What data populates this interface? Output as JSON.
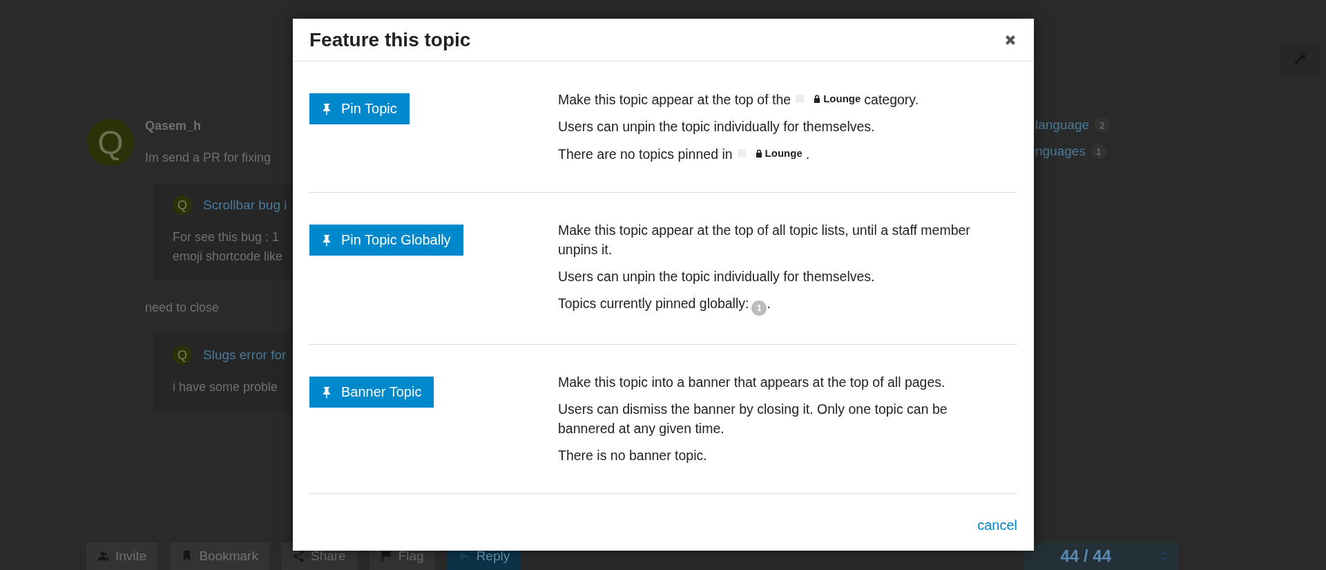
{
  "post": {
    "avatar_letter": "Q",
    "username": "Qasem_h",
    "body": [
      {
        "kind": "text",
        "text": "Im send a PR for fixing"
      },
      {
        "kind": "quote",
        "avatar_letter": "Q",
        "title": "Scrollbar bug i",
        "lines": [
          "For see this bug : 1",
          "emoji shortcode like"
        ]
      },
      {
        "kind": "text",
        "text": "need to close"
      },
      {
        "kind": "quote",
        "avatar_letter": "Q",
        "title": "Slugs error for",
        "lines": [
          "i have some proble"
        ]
      }
    ]
  },
  "links": [
    {
      "label": "language",
      "count": "2"
    },
    {
      "label": "nguages",
      "count": "1"
    }
  ],
  "footer_buttons": [
    {
      "label": "Invite",
      "kind": "invite"
    },
    {
      "label": "Bookmark",
      "kind": "bookmark"
    },
    {
      "label": "Share",
      "kind": "share"
    },
    {
      "label": "Flag",
      "kind": "flag"
    },
    {
      "label": "Reply",
      "kind": "reply"
    }
  ],
  "progress": {
    "text": "44 / 44",
    "level": 1
  },
  "modal": {
    "title": "Feature this topic",
    "sections": [
      {
        "button": "Pin Topic",
        "paragraphs": [
          [
            {
              "kind": "text",
              "text": "Make this topic appear at the top of the"
            },
            {
              "kind": "category",
              "text": "Lounge"
            },
            {
              "kind": "text",
              "text": "category."
            }
          ],
          [
            {
              "kind": "text",
              "text": "Users can unpin the topic individually for themselves."
            }
          ],
          [
            {
              "kind": "text",
              "text": "There are no topics pinned in"
            },
            {
              "kind": "category",
              "text": "Lounge"
            },
            {
              "kind": "text",
              "text": "."
            }
          ]
        ]
      },
      {
        "button": "Pin Topic Globally",
        "paragraphs": [
          [
            {
              "kind": "text",
              "text": "Make this topic appear at the top of all topic lists, until a staff member unpins it."
            }
          ],
          [
            {
              "kind": "text",
              "text": "Users can unpin the topic individually for themselves."
            }
          ],
          [
            {
              "kind": "text",
              "text": "Topics currently pinned globally:"
            },
            {
              "kind": "count",
              "text": "1"
            },
            {
              "kind": "text",
              "text": "."
            }
          ]
        ]
      },
      {
        "button": "Banner Topic",
        "paragraphs": [
          [
            {
              "kind": "text",
              "text": "Make this topic into a banner that appears at the top of all pages."
            }
          ],
          [
            {
              "kind": "text",
              "text": "Users can dismiss the banner by closing it. Only one topic can be bannered at any given time."
            }
          ],
          [
            {
              "kind": "text",
              "text": "There is no banner topic."
            }
          ]
        ]
      }
    ],
    "cancel": "cancel"
  }
}
